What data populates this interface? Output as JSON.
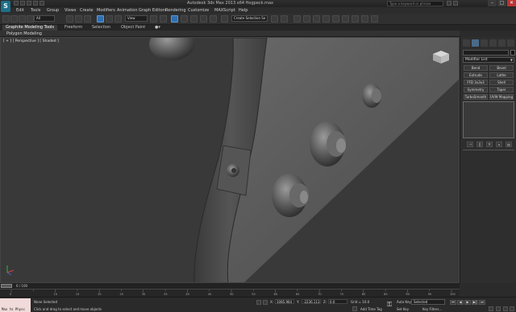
{
  "window": {
    "app_icon": "3ds-max-logo",
    "title": "Autodesk 3ds Max 2013 x64    Hogpeck.max",
    "search_placeholder": "Type a keyword or phrase",
    "minimize": "–",
    "maximize": "□",
    "close": "✕"
  },
  "menu": [
    "Edit",
    "Tools",
    "Group",
    "Views",
    "Create",
    "Modifiers",
    "Animation",
    "Graph Editors",
    "Rendering",
    "Customize",
    "MAXScript",
    "Help"
  ],
  "toolbar": {
    "filter_select": "All",
    "ref_coord_select": "View",
    "named_sel_set": "Create Selection Se"
  },
  "ribbon": {
    "tabs": [
      "Graphite Modeling Tools",
      "Freeform",
      "Selection",
      "Object Paint"
    ],
    "panel_label": "Polygon Modeling"
  },
  "viewport": {
    "label": "[ + ] [ Perspective ] [ Shaded ]"
  },
  "command_panel": {
    "modifier_list": "Modifier List",
    "modifiers": [
      "Bend",
      "Bevel",
      "Extrude",
      "Lathe",
      "FFD 3x3x3",
      "Shell",
      "Symmetry",
      "Taper",
      "TurboSmooth",
      "UVW Mapping Cle"
    ],
    "stack_tools": [
      "⊣",
      "‖",
      "∀",
      "⌂",
      "▤"
    ]
  },
  "timeline": {
    "slider_label": "0 / 100",
    "ticks": [
      "0",
      "10",
      "15",
      "20",
      "25",
      "30",
      "35",
      "40",
      "45",
      "50",
      "55",
      "60",
      "65",
      "70",
      "75",
      "80",
      "85",
      "90",
      "95",
      "100"
    ]
  },
  "status": {
    "maxscript_text": "Max to Physc",
    "selection": "None Selected",
    "prompt": "Click and drag to select and move objects",
    "x_label": "X:",
    "x_value": "1085.964",
    "y_label": "Y:",
    "y_value": "-2236.113",
    "z_label": "Z:",
    "z_value": "0.0",
    "grid": "Grid = 10.0",
    "add_time_tag": "Add Time Tag",
    "auto_key": "Auto Key",
    "set_key": "Set Key",
    "key_mode": "Selected",
    "key_filters": "Key Filters...",
    "play_controls": [
      "⏮",
      "◀",
      "▶",
      "▶|",
      "⏭"
    ]
  }
}
